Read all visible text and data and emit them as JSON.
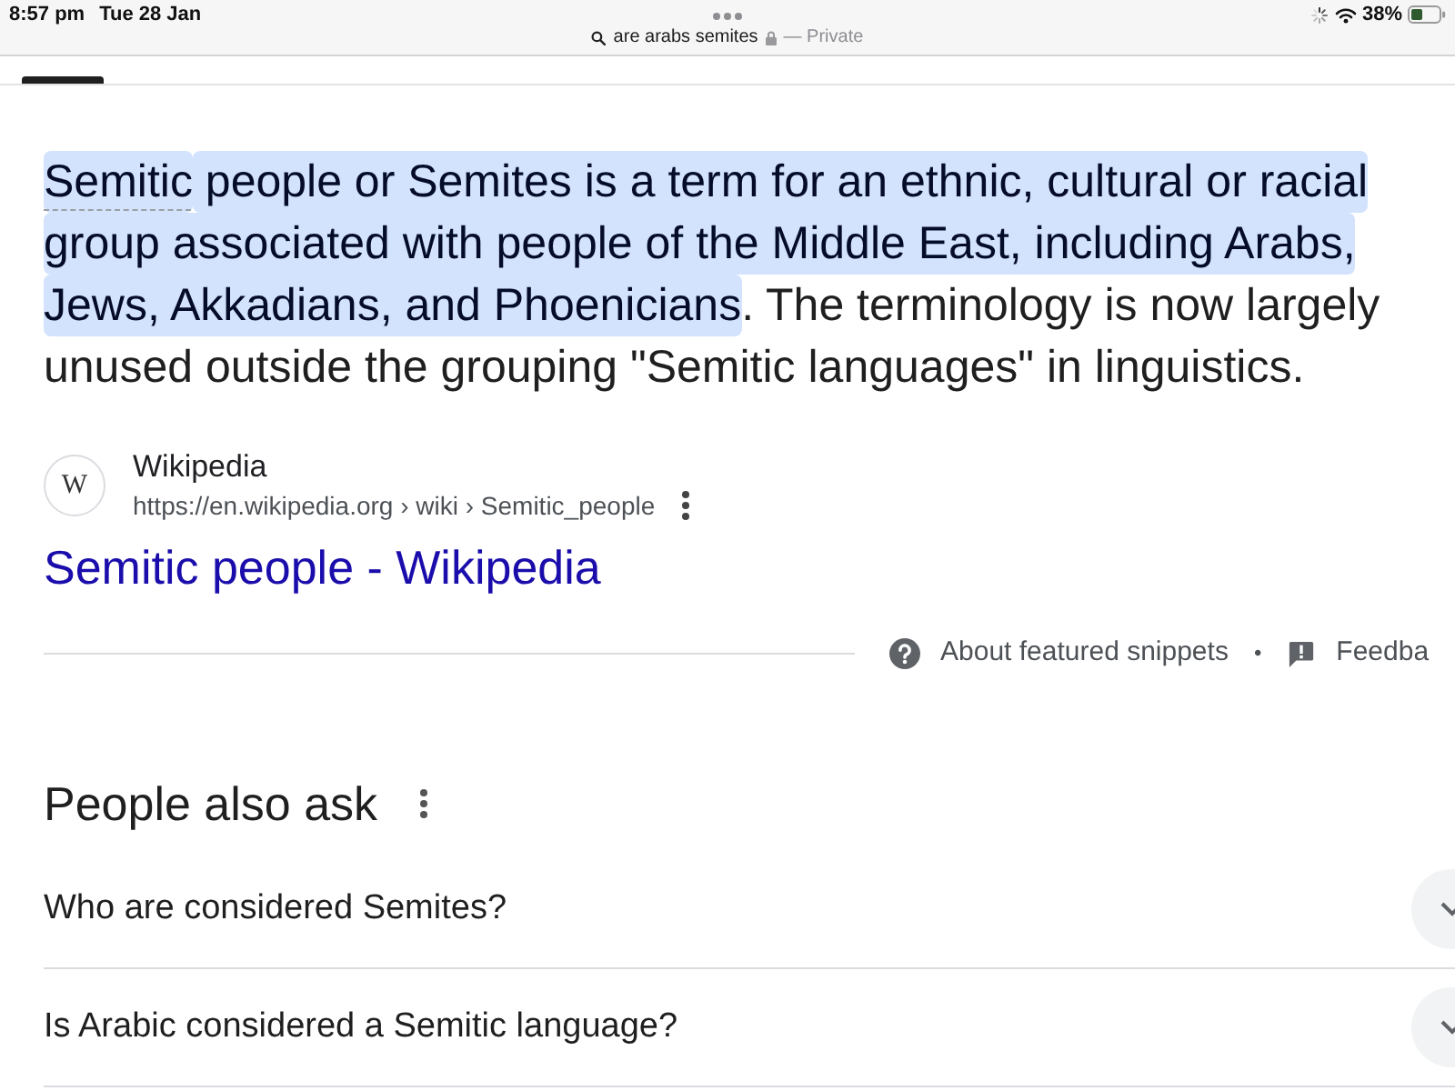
{
  "status_bar": {
    "time": "8:57 pm",
    "date": "Tue 28 Jan",
    "battery": "38%"
  },
  "address_bar": {
    "query": "are arabs semites",
    "mode": "— Private"
  },
  "featured_snippet": {
    "segments": [
      {
        "text": "Semitic",
        "kind": "defined",
        "highlighted": true
      },
      {
        "text": " people or Semites is a term for an ethnic, cultural or racial group associated with people of the Middle East, including Arabs, Jews, Akkadians, and Phoenicians",
        "kind": "plain",
        "highlighted": true
      },
      {
        "text": ". The terminology is now largely unused outside the grouping \"Semitic languages\" in linguistics.",
        "kind": "plain",
        "highlighted": false
      }
    ],
    "source": {
      "favicon": "W",
      "name": "Wikipedia",
      "url": "https://en.wikipedia.org › wiki › Semitic_people"
    },
    "title": "Semitic people - Wikipedia",
    "footer": {
      "about": "About featured snippets",
      "separator": "•",
      "feedback": "Feedba"
    }
  },
  "people_also_ask": {
    "heading": "People also ask",
    "questions": [
      {
        "text": "Who are considered Semites?",
        "expanded": false
      },
      {
        "text": "Is Arabic considered a Semitic language?",
        "expanded": false
      }
    ]
  }
}
